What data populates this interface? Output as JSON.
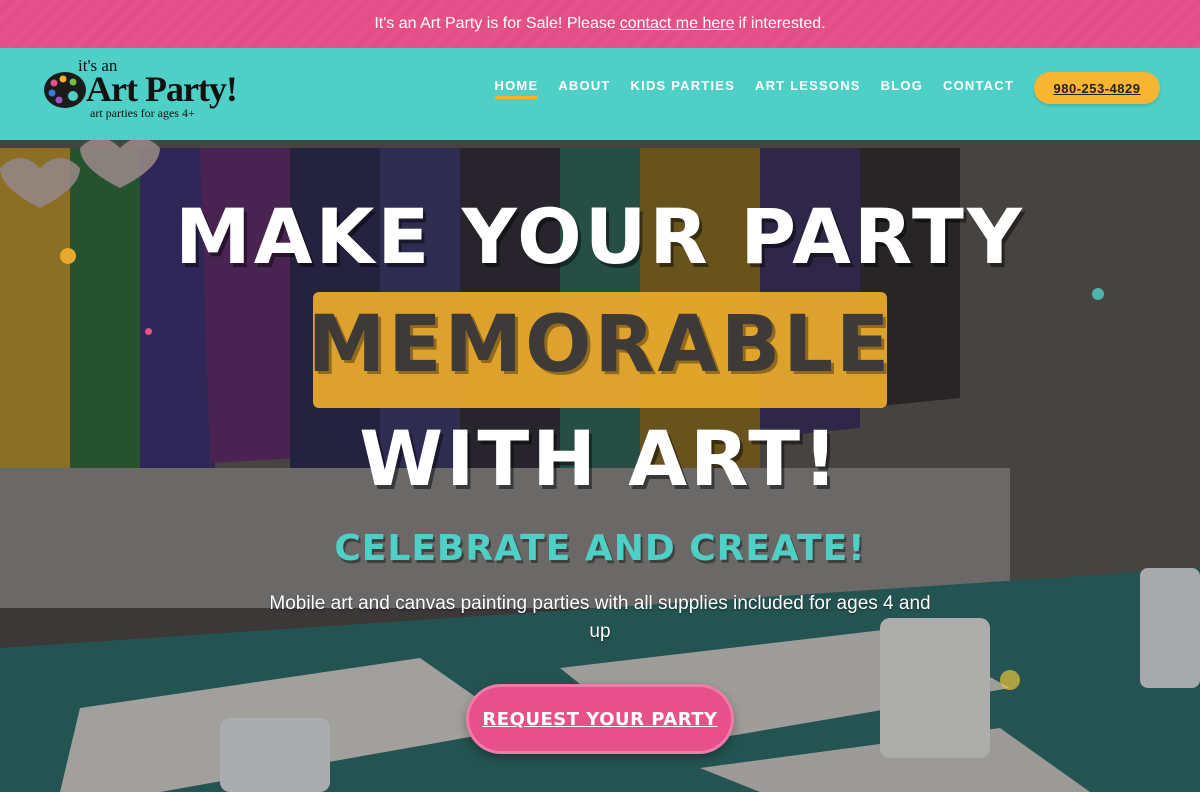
{
  "announcement": {
    "before": "It's an Art Party is for Sale! Please",
    "link": "contact me here",
    "after": "if interested."
  },
  "logo": {
    "its_an": "it's an",
    "brand": "Art Party!",
    "tagline": "art parties for ages 4+"
  },
  "nav": {
    "items": [
      "HOME",
      "ABOUT",
      "KIDS PARTIES",
      "ART LESSONS",
      "BLOG",
      "CONTACT"
    ],
    "active": "HOME",
    "phone": "980-253-4829"
  },
  "hero": {
    "line1": "MAKE YOUR PARTY",
    "line2": "MEMORABLE",
    "line3": "WITH ART!",
    "subheading": "CELEBRATE AND CREATE!",
    "description": "Mobile art and canvas painting parties with all supplies included for ages 4 and up",
    "cta": "REQUEST YOUR PARTY"
  },
  "colors": {
    "pink": "#e8508a",
    "teal": "#4fd0c6",
    "yellow": "#f4b431",
    "dark": "#3d3a38"
  }
}
